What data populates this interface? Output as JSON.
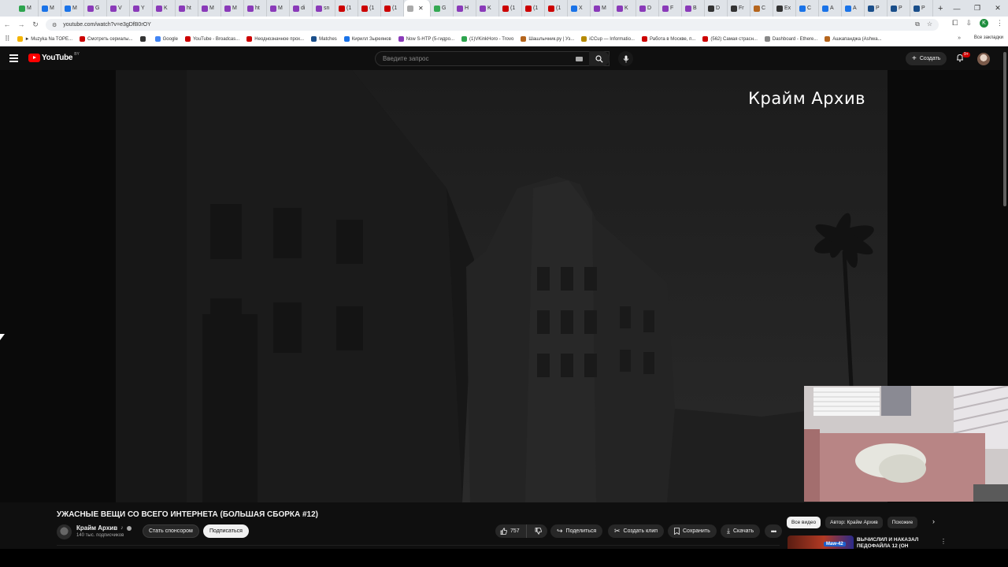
{
  "browser": {
    "tabs": [
      {
        "label": "M",
        "color": "#2da44e"
      },
      {
        "label": "M",
        "color": "#1a73e8"
      },
      {
        "label": "M",
        "color": "#1a73e8"
      },
      {
        "label": "G",
        "color": "#8a3ab9"
      },
      {
        "label": "V",
        "color": "#8a3ab9"
      },
      {
        "label": "Y",
        "color": "#8a3ab9"
      },
      {
        "label": "K",
        "color": "#8a3ab9"
      },
      {
        "label": "ht",
        "color": "#8a3ab9"
      },
      {
        "label": "M",
        "color": "#8a3ab9"
      },
      {
        "label": "M",
        "color": "#8a3ab9"
      },
      {
        "label": "ht",
        "color": "#8a3ab9"
      },
      {
        "label": "M",
        "color": "#8a3ab9"
      },
      {
        "label": "di",
        "color": "#8a3ab9"
      },
      {
        "label": "sn",
        "color": "#8a3ab9"
      },
      {
        "label": "(1",
        "color": "#cc0000"
      },
      {
        "label": "(1",
        "color": "#cc0000"
      },
      {
        "label": "(1",
        "color": "#cc0000"
      }
    ],
    "active_tab": {
      "label": "",
      "color": "#aaaaaa"
    },
    "tabs_after": [
      {
        "label": "G",
        "color": "#34a853"
      },
      {
        "label": "H",
        "color": "#8a3ab9"
      },
      {
        "label": "K",
        "color": "#8a3ab9"
      },
      {
        "label": "(1",
        "color": "#cc0000"
      },
      {
        "label": "(1",
        "color": "#cc0000"
      },
      {
        "label": "(1",
        "color": "#cc0000"
      },
      {
        "label": "X",
        "color": "#1a73e8"
      },
      {
        "label": "M",
        "color": "#8a3ab9"
      },
      {
        "label": "K",
        "color": "#8a3ab9"
      },
      {
        "label": "D",
        "color": "#8a3ab9"
      },
      {
        "label": "F",
        "color": "#8a3ab9"
      },
      {
        "label": "B",
        "color": "#8a3ab9"
      },
      {
        "label": "D",
        "color": "#333333"
      },
      {
        "label": "Fr",
        "color": "#333333"
      },
      {
        "label": "C",
        "color": "#b5651d"
      },
      {
        "label": "Ex",
        "color": "#333333"
      },
      {
        "label": "C",
        "color": "#1a73e8"
      },
      {
        "label": "A",
        "color": "#1a73e8"
      },
      {
        "label": "A",
        "color": "#1a73e8"
      },
      {
        "label": "P",
        "color": "#1a4e8a"
      },
      {
        "label": "P",
        "color": "#1a4e8a"
      },
      {
        "label": "P",
        "color": "#1a4e8a"
      }
    ],
    "url": "youtube.com/watch?v=e3gDfB0rOY",
    "bookmarks": [
      {
        "label": "► Muzyka Na TOPE...",
        "color": "#f4b400"
      },
      {
        "label": "Смотреть сериалы...",
        "color": "#cc0000"
      },
      {
        "label": "",
        "color": "#333333"
      },
      {
        "label": "Google",
        "color": "#4285f4"
      },
      {
        "label": "YouTube - Broadcas...",
        "color": "#cc0000"
      },
      {
        "label": "Неоднозначное прох...",
        "color": "#cc0000"
      },
      {
        "label": "Matches",
        "color": "#1a4e8a"
      },
      {
        "label": "Кирилл Зыреянов",
        "color": "#1a73e8"
      },
      {
        "label": "Now S-HTP (5-гидро...",
        "color": "#8a3ab9"
      },
      {
        "label": "(1)VKinkHoro - Trovo",
        "color": "#2da44e"
      },
      {
        "label": "Шашлычник.ру | Уз...",
        "color": "#b5651d"
      },
      {
        "label": "iCCup — Informatio...",
        "color": "#b58900"
      },
      {
        "label": "Работа в Москве, п...",
        "color": "#cc0000"
      },
      {
        "label": "(562) Самая страсн...",
        "color": "#cc0000"
      },
      {
        "label": "Dashboard - Ethere...",
        "color": "#888888"
      },
      {
        "label": "Ашкапанджа (Ashwa...",
        "color": "#b5651d"
      }
    ],
    "all_bookmarks": "Все закладки"
  },
  "youtube": {
    "logo_text": "YouTube",
    "region": "BY",
    "search_placeholder": "Введите запрос",
    "create_label": "Создать",
    "notif_count": "9+"
  },
  "video": {
    "watermark": "Крайм Архив",
    "title": "УЖАСНЫЕ ВЕЩИ СО ВСЕГО ИНТЕРНЕТА (БОЛЬШАЯ СБОРКА #12)",
    "channel": "Крайм Архив",
    "subscribers": "140 тыс. подписчиков",
    "sponsor_label": "Стать спонсором",
    "subscribe_label": "Подписаться",
    "likes": "757",
    "share_label": "Поделиться",
    "clip_label": "Создать клип",
    "save_label": "Сохранить",
    "download_label": "Скачать"
  },
  "sidebar": {
    "chips": [
      "Все видео",
      "Автор: Крайм Архив",
      "Похожие"
    ],
    "rec_title": "ВЫЧИСЛИЛ И НАКАЗАЛ ПЕДОФАЙЛА 12 (ОН",
    "rec_badge": "Maw-42"
  }
}
